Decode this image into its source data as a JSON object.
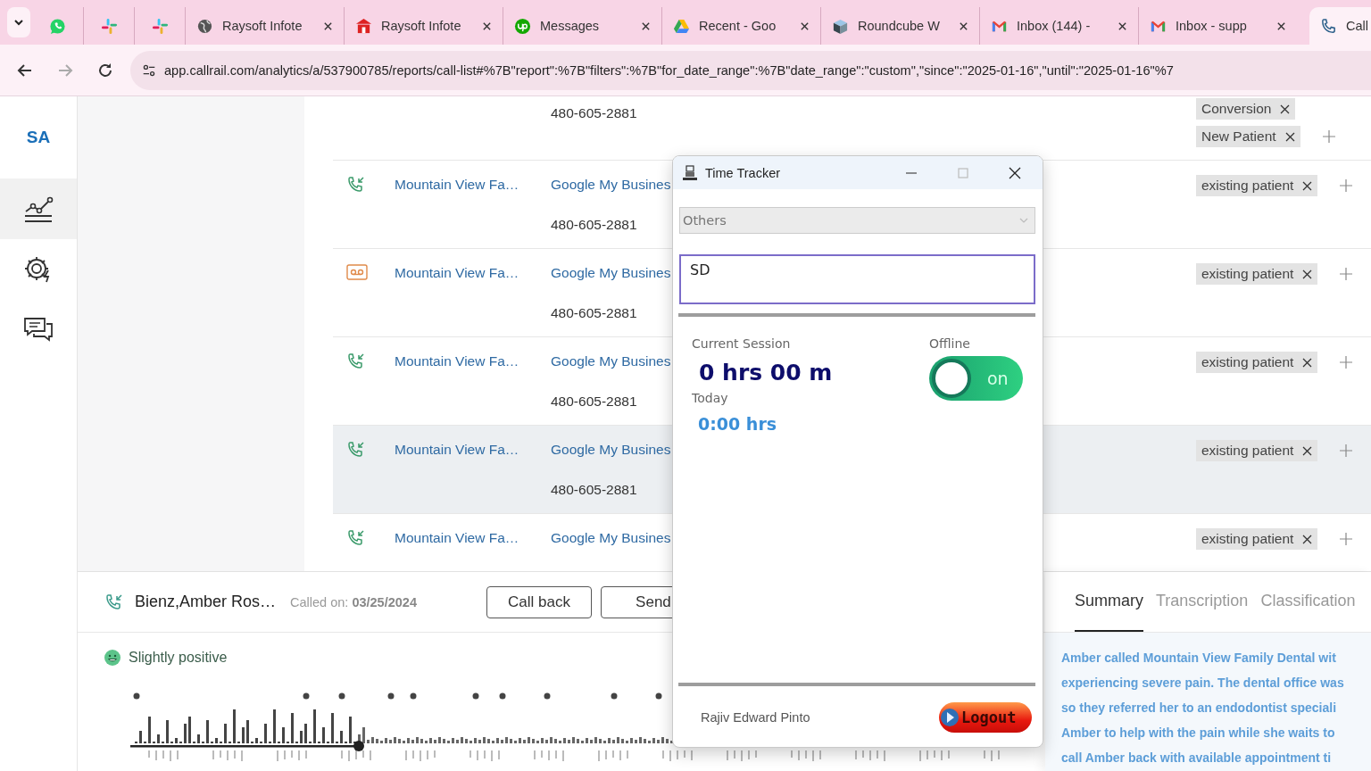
{
  "browser": {
    "tabs": [
      {
        "kind": "pinned",
        "selected": false
      },
      {
        "kind": "pinned",
        "selected": false
      },
      {
        "kind": "pinned",
        "selected": false
      },
      {
        "kind": "page",
        "title": "Raysoft Infote",
        "selected": false
      },
      {
        "kind": "page",
        "title": "Raysoft Infote",
        "selected": false
      },
      {
        "kind": "page",
        "title": "Messages",
        "selected": false
      },
      {
        "kind": "page",
        "title": "Recent - Goo",
        "selected": false
      },
      {
        "kind": "page",
        "title": "Roundcube W",
        "selected": false
      },
      {
        "kind": "page",
        "title": "Inbox (144) -",
        "selected": false
      },
      {
        "kind": "page",
        "title": "Inbox - supp",
        "selected": false
      },
      {
        "kind": "page",
        "title": "Call",
        "selected": true
      }
    ],
    "url": "app.callrail.com/analytics/a/537900785/reports/call-list#%7B\"report\":%7B\"filters\":%7B\"for_date_range\":%7B\"date_range\":\"custom\",\"since\":\"2025-01-16\",\"until\":\"2025-01-16\"%7"
  },
  "sidebar": {
    "avatar": "SA",
    "items": [
      {
        "selected": true
      },
      {
        "selected": false
      },
      {
        "selected": false
      }
    ]
  },
  "calls": {
    "rows": [
      {
        "kind": "continued",
        "phone": "480-605-2881",
        "tags": [
          "Conversion",
          "New Patient"
        ],
        "hovered": false
      },
      {
        "kind": "inbound",
        "name": "Mountain View Fa…",
        "source": "Google My Busines",
        "phone": "480-605-2881",
        "tags": [
          "existing patient"
        ],
        "hovered": false
      },
      {
        "kind": "voicemail",
        "name": "Mountain View Fa…",
        "source": "Google My Busines",
        "phone": "480-605-2881",
        "tags": [
          "existing patient"
        ],
        "hovered": false
      },
      {
        "kind": "inbound",
        "name": "Mountain View Fa…",
        "source": "Google My Busines",
        "phone": "480-605-2881",
        "tags": [
          "existing patient"
        ],
        "hovered": false
      },
      {
        "kind": "inbound",
        "name": "Mountain View Fa…",
        "source": "Google My Busines",
        "phone": "480-605-2881",
        "tags": [
          "existing patient"
        ],
        "hovered": true
      },
      {
        "kind": "inbound",
        "name": "Mountain View Fa…",
        "source": "Google My Busines",
        "tags": [
          "existing patient"
        ],
        "hovered": false
      }
    ]
  },
  "call_detail": {
    "caller": "Bienz,Amber Ros…",
    "called_on": "Called on: **03/25/2024**",
    "buttons": [
      "Call back",
      "Send"
    ],
    "sentiment": "Slightly positive"
  },
  "summary_panel": {
    "tabs": [
      {
        "label": "Summary",
        "selected": true
      },
      {
        "label": "Transcription",
        "selected": false
      },
      {
        "label": "Classification",
        "selected": false
      }
    ],
    "lines": [
      "Amber called Mountain View Family Dental wit",
      "experiencing severe pain. The dental office was",
      "so they referred her to an endodontist speciali",
      "Amber to help with the pain while she waits to",
      "call Amber back with available appointment ti"
    ]
  },
  "time_tracker": {
    "title": "Time Tracker",
    "project": {
      "value": "Others",
      "disabled": true
    },
    "note": "SD",
    "session_label": "Current Session",
    "session_time": "0 hrs 00 m",
    "status": "Offline",
    "toggle": {
      "label": "on",
      "on": true
    },
    "today_label": "Today",
    "today_time": "0:00 hrs",
    "user": "Rajiv Edward Pinto",
    "logout": "Logout"
  }
}
